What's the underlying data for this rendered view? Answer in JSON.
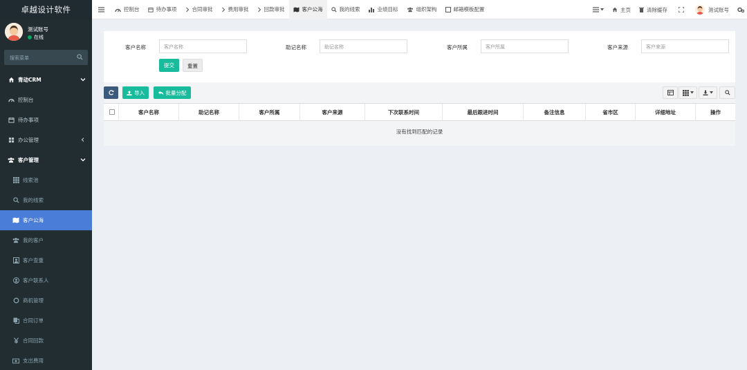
{
  "app": {
    "logo_text": "卓越设计软件"
  },
  "user": {
    "name": "测试账号",
    "status": "在线"
  },
  "sidebar": {
    "search_placeholder": "搜索菜单",
    "items": [
      {
        "label": "青动CRM",
        "icon": "home-icon",
        "type": "header",
        "arrow": "chevron-down"
      },
      {
        "label": "控制台",
        "icon": "dashboard-icon",
        "type": "item"
      },
      {
        "label": "待办事项",
        "icon": "calendar-icon",
        "type": "item"
      },
      {
        "label": "办公管理",
        "icon": "grid-icon",
        "type": "item",
        "arrow": "chevron-left"
      },
      {
        "label": "客户管理",
        "icon": "users-icon",
        "type": "header",
        "arrow": "chevron-down"
      },
      {
        "label": "线索池",
        "icon": "th-icon",
        "type": "sub"
      },
      {
        "label": "我的线索",
        "icon": "search-icon",
        "type": "sub"
      },
      {
        "label": "客户公海",
        "icon": "map-icon",
        "type": "sub",
        "active": true
      },
      {
        "label": "我的客户",
        "icon": "users-icon",
        "type": "sub"
      },
      {
        "label": "客户查重",
        "icon": "user-box-icon",
        "type": "sub"
      },
      {
        "label": "客户联系人",
        "icon": "user-circle-icon",
        "type": "sub"
      },
      {
        "label": "商机管理",
        "icon": "circle-icon",
        "type": "sub"
      },
      {
        "label": "合同订单",
        "icon": "copy-icon",
        "type": "sub"
      },
      {
        "label": "合同回款",
        "icon": "yen-icon",
        "type": "sub"
      },
      {
        "label": "支出费用",
        "icon": "money-icon",
        "type": "sub"
      }
    ]
  },
  "topbar": {
    "menu_icon": "bars-icon",
    "tabs": [
      {
        "label": "控制台",
        "icon": "dashboard-icon"
      },
      {
        "label": "待办事项",
        "icon": "calendar-icon"
      },
      {
        "label": "合同审批",
        "icon": "chevron-right-icon"
      },
      {
        "label": "费用审批",
        "icon": "chevron-right-icon"
      },
      {
        "label": "回款审批",
        "icon": "chevron-right-icon"
      },
      {
        "label": "客户公海",
        "icon": "map-icon",
        "active": true
      },
      {
        "label": "我的线索",
        "icon": "search-icon"
      },
      {
        "label": "业绩目标",
        "icon": "bar-chart-icon"
      },
      {
        "label": "组织架构",
        "icon": "users-icon"
      },
      {
        "label": "邮箱模板配置",
        "icon": "square-icon"
      }
    ],
    "right": {
      "home_label": "主页",
      "cache_label": "清除缓存",
      "account_label": "测试账号"
    }
  },
  "filters": {
    "fields": [
      {
        "label": "客户名称",
        "placeholder": "客户名称"
      },
      {
        "label": "助记名称",
        "placeholder": "助记名称"
      },
      {
        "label": "客户所属",
        "placeholder": "客户所属"
      },
      {
        "label": "客户来源",
        "placeholder": "客户来源"
      }
    ],
    "submit_label": "提交",
    "reset_label": "重置"
  },
  "toolbar": {
    "refresh_icon": "refresh-icon",
    "import_label": "导入",
    "assign_label": "批量分配"
  },
  "table": {
    "columns": [
      "客户名称",
      "助记名称",
      "客户所属",
      "客户来源",
      "下次联系时间",
      "最后跟进时间",
      "备注信息",
      "省市区",
      "详细地址",
      "操作"
    ],
    "empty_text": "没有找到匹配的记录"
  },
  "colors": {
    "sidebar_bg": "#222d32",
    "sidebar_active": "#4a7dd8",
    "primary_green": "#18bc9c",
    "refresh_button": "#3c5a7c",
    "status_online": "#00a65a"
  }
}
